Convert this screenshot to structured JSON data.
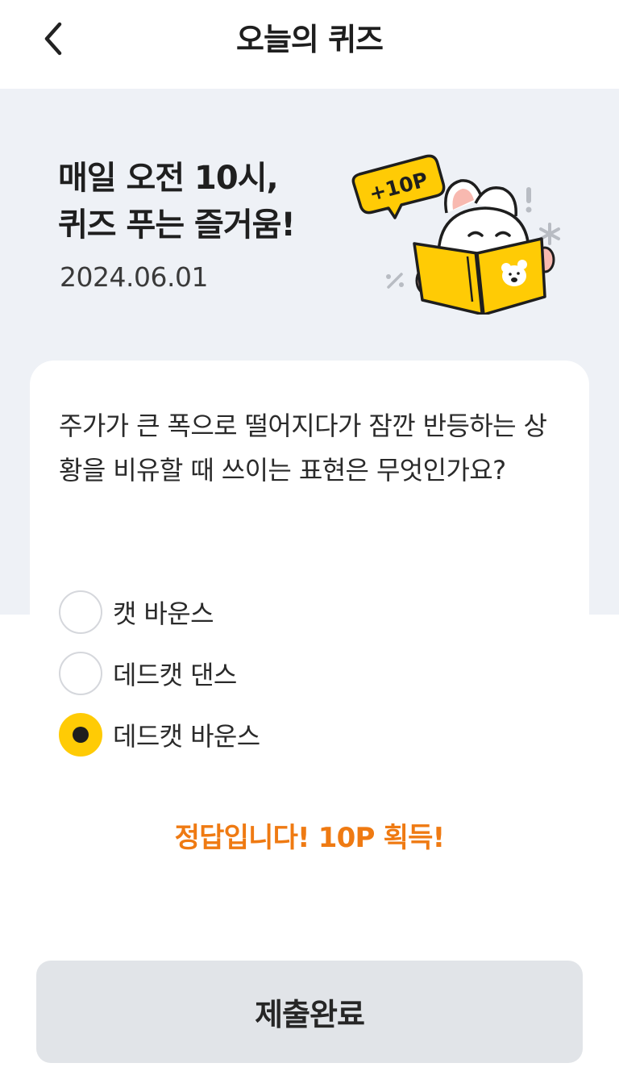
{
  "header": {
    "title": "오늘의 퀴즈",
    "back_icon": "chevron-left-icon"
  },
  "hero": {
    "title_line1": "매일 오전 10시,",
    "title_line2": "퀴즈 푸는 즐거움!",
    "date": "2024.06.01",
    "bubble_text": "+10P"
  },
  "quiz": {
    "question": "주가가 큰 폭으로 떨어지다가 잠깐 반등하는 상황을 비유할 때 쓰이는 표현은 무엇인가요?",
    "options": [
      {
        "label": "캣 바운스",
        "selected": false
      },
      {
        "label": "데드캣 댄스",
        "selected": false
      },
      {
        "label": "데드캣 바운스",
        "selected": true
      }
    ],
    "result": "정답입니다! 10P 획득!"
  },
  "submit": {
    "label": "제출완료"
  },
  "colors": {
    "accent": "#ffcb05",
    "result_text": "#ef7a12",
    "hero_background": "#eef1f6",
    "button_background": "#e1e4e8"
  }
}
